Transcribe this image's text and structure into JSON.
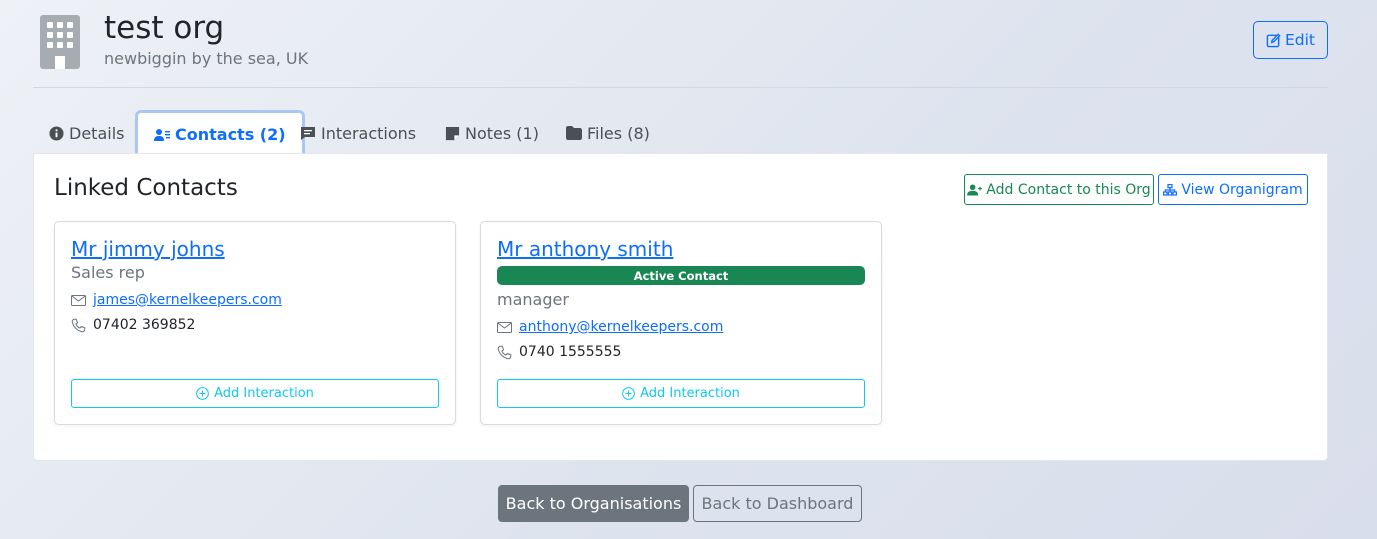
{
  "org": {
    "name": "test org",
    "location": "newbiggin by the sea, UK",
    "edit_label": "Edit"
  },
  "tabs": [
    {
      "label": "Details",
      "icon": "info-circle-icon"
    },
    {
      "label": "Contacts (2)",
      "icon": "person-lines-icon",
      "active": true
    },
    {
      "label": "Interactions",
      "icon": "chat-square-icon"
    },
    {
      "label": "Notes (1)",
      "icon": "sticky-note-icon"
    },
    {
      "label": "Files (8)",
      "icon": "folder-icon"
    }
  ],
  "panel": {
    "title": "Linked Contacts",
    "add_contact_label": "Add Contact to this Org",
    "view_organigram_label": "View Organigram"
  },
  "contacts": [
    {
      "name": "Mr jimmy johns",
      "role": "Sales rep",
      "email": "james@kernelkeepers.com",
      "phone": "07402 369852",
      "add_interaction_label": "Add Interaction"
    },
    {
      "name": "Mr anthony smith",
      "badge": "Active Contact",
      "role": "manager",
      "email": "anthony@kernelkeepers.com",
      "phone": "0740 1555555",
      "add_interaction_label": "Add Interaction"
    }
  ],
  "footer": {
    "back_orgs_label": "Back to Organisations",
    "back_dashboard_label": "Back to Dashboard"
  },
  "colors": {
    "primary": "#0d6efd",
    "success": "#198754",
    "info": "#0dcaf0",
    "secondary": "#6c757d"
  }
}
